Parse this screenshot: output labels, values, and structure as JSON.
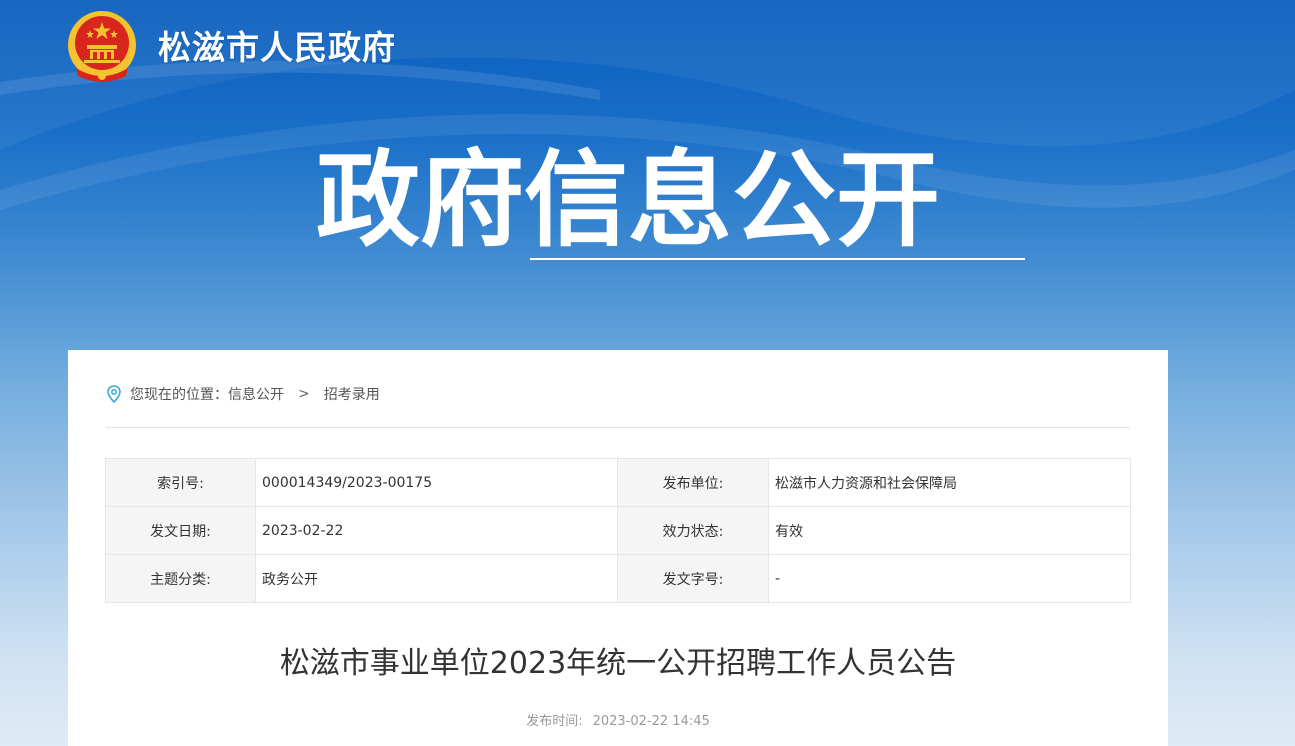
{
  "site": {
    "title": "松滋市人民政府",
    "emblem_icon": "national-emblem-icon"
  },
  "hero": {
    "title": "政府信息公开"
  },
  "breadcrumb": {
    "prefix": "您现在的位置：",
    "items": [
      "信息公开",
      "招考录用"
    ],
    "separator": ">",
    "icon": "location-pin-icon"
  },
  "meta": {
    "rows": [
      {
        "label1": "索引号:",
        "value1": "000014349/2023-00175",
        "label2": "发布单位:",
        "value2": "松滋市人力资源和社会保障局"
      },
      {
        "label1": "发文日期:",
        "value1": "2023-02-22",
        "label2": "效力状态:",
        "value2": "有效"
      },
      {
        "label1": "主题分类:",
        "value1": "政务公开",
        "label2": "发文字号:",
        "value2": "-"
      }
    ]
  },
  "article": {
    "title": "松滋市事业单位2023年统一公开招聘工作人员公告",
    "published_label": "发布时间:",
    "published_value": "2023-02-22 14:45"
  },
  "colors": {
    "header_blue": "#0a5dbe",
    "emblem_red": "#d8261f",
    "emblem_gold": "#f4c430",
    "pin_blue": "#3ba7d6"
  }
}
